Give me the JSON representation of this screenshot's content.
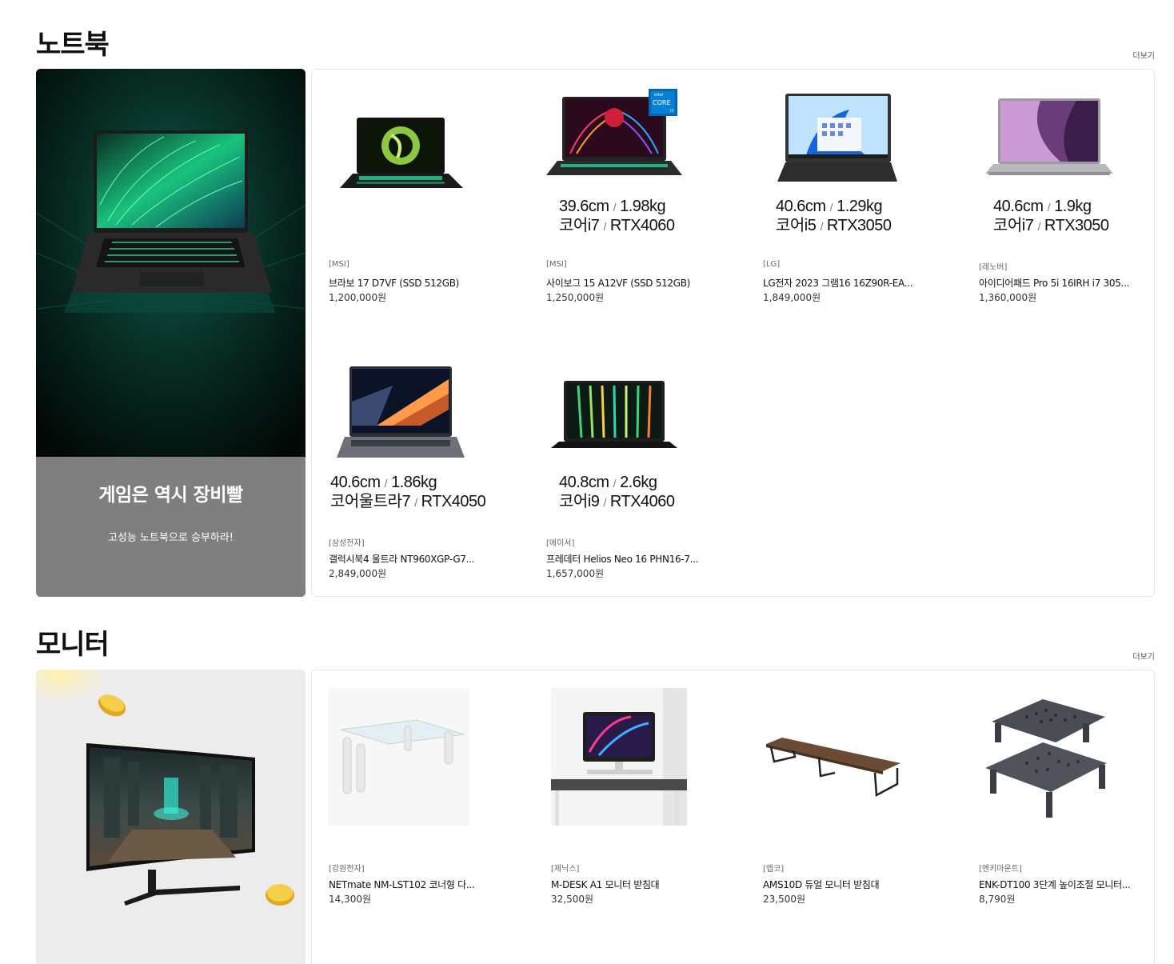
{
  "sections": [
    {
      "title": "노트북",
      "more": "더보기",
      "banner": {
        "headline": "게임은 역시 장비빨",
        "sub": "고성능 노트북으로 승부하라!"
      },
      "products": [
        {
          "brand": "[MSI]",
          "name": "브라보 17 D7VF (SSD 512GB)",
          "price": "1,200,000원",
          "spec1a": "",
          "spec1b": "",
          "spec2a": "",
          "spec2b": ""
        },
        {
          "brand": "[MSI]",
          "name": "사이보그 15 A12VF (SSD 512GB)",
          "price": "1,250,000원",
          "spec1a": "39.6cm",
          "spec1b": "1.98kg",
          "spec2a": "코어i7",
          "spec2b": "RTX4060"
        },
        {
          "brand": "[LG]",
          "name": "LG전자 2023 그램16 16Z90R-EA...",
          "price": "1,849,000원",
          "spec1a": "40.6cm",
          "spec1b": "1.29kg",
          "spec2a": "코어i5",
          "spec2b": "RTX3050"
        },
        {
          "brand": "[레노버]",
          "name": "아이디어패드 Pro 5i 16IRH i7 305...",
          "price": "1,360,000원",
          "spec1a": "40.6cm",
          "spec1b": "1.9kg",
          "spec2a": "코어i7",
          "spec2b": "RTX3050"
        },
        {
          "brand": "[삼성전자]",
          "name": "갤럭시북4 울트라 NT960XGP-G7...",
          "price": "2,849,000원",
          "spec1a": "40.6cm",
          "spec1b": "1.86kg",
          "spec2a": "코어울트라7",
          "spec2b": "RTX4050"
        },
        {
          "brand": "[에이서]",
          "name": "프레데터 Helios Neo 16 PHN16-7...",
          "price": "1,657,000원",
          "spec1a": "40.8cm",
          "spec1b": "2.6kg",
          "spec2a": "코어i9",
          "spec2b": "RTX4060"
        }
      ]
    },
    {
      "title": "모니터",
      "more": "더보기",
      "products": [
        {
          "brand": "[강원전자]",
          "name": "NETmate NM-LST102 코너형 다...",
          "price": "14,300원"
        },
        {
          "brand": "[제닉스]",
          "name": "M-DESK A1 모니터 받침대",
          "price": "32,500원"
        },
        {
          "brand": "[엡코]",
          "name": "AMS10D 듀얼 모니터 받침대",
          "price": "23,500원"
        },
        {
          "brand": "[엔키마운트]",
          "name": "ENK-DT100 3단계 높이조절 모니터...",
          "price": "8,790원"
        }
      ]
    }
  ],
  "spec_sep": "/",
  "colors": {
    "banner_caption_bg": "#7f7f7f",
    "banner_dark_bg": "#041a16",
    "accent_green": "#1fd39a"
  }
}
